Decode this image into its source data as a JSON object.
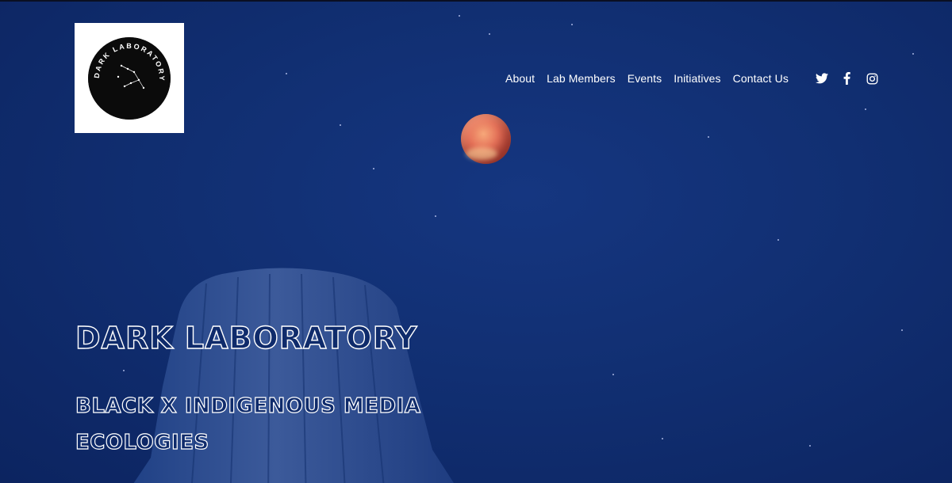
{
  "site": {
    "logo_text": "DARK LABORATORY"
  },
  "nav": {
    "items": [
      {
        "label": "About"
      },
      {
        "label": "Lab Members"
      },
      {
        "label": "Events"
      },
      {
        "label": "Initiatives"
      },
      {
        "label": "Contact Us"
      }
    ],
    "social": [
      {
        "icon": "twitter-icon"
      },
      {
        "icon": "facebook-icon"
      },
      {
        "icon": "instagram-icon"
      }
    ]
  },
  "hero": {
    "title": "DARK LABORATORY",
    "subtitle": "BLACK X INDIGENOUS MEDIA ECOLOGIES"
  },
  "colors": {
    "background": "#0f2b6b",
    "moon": "#e6735a",
    "text": "#ffffff"
  }
}
